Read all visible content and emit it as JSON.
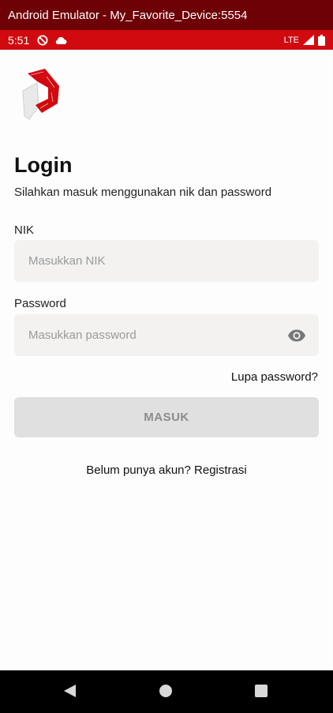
{
  "window": {
    "title": "Android Emulator - My_Favorite_Device:5554"
  },
  "status_bar": {
    "time": "5:51",
    "icons": [
      "do-not-disturb-icon",
      "cloud-icon"
    ],
    "network": "LTE",
    "right_icons": [
      "signal-icon",
      "battery-icon"
    ]
  },
  "colors": {
    "window_bar": "#6e0106",
    "status_bar": "#d10a10",
    "brand_red": "#d10a10",
    "field_bg": "#f3f2f1",
    "button_disabled": "#e0e0e0"
  },
  "login": {
    "title": "Login",
    "subtitle": "Silahkan masuk menggunakan nik dan password",
    "nik_label": "NIK",
    "nik_placeholder": "Masukkan NIK",
    "nik_value": "",
    "password_label": "Password",
    "password_placeholder": "Masukkan password",
    "password_value": "",
    "password_toggle_icon": "eye-icon",
    "forgot_password": "Lupa password?",
    "submit_label": "MASUK",
    "submit_enabled": false,
    "register_prompt": "Belum punya akun?",
    "register_link": "Registrasi"
  },
  "nav_bar": {
    "buttons": [
      "back-icon",
      "home-icon",
      "recents-icon"
    ]
  }
}
